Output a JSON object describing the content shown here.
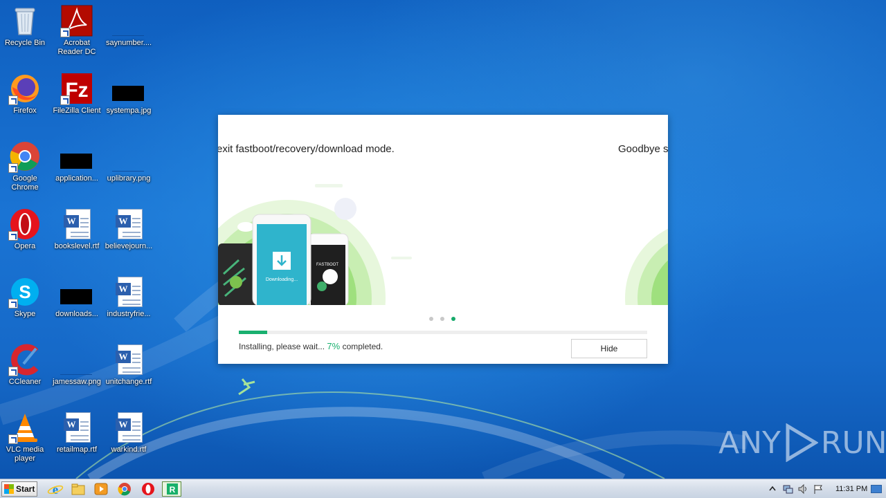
{
  "desktop": {
    "icons": [
      {
        "label": "Recycle Bin"
      },
      {
        "label": "Acrobat Reader DC"
      },
      {
        "label": "saynumber...."
      },
      {
        "label": "Firefox"
      },
      {
        "label": "FileZilla Client"
      },
      {
        "label": "systempa.jpg"
      },
      {
        "label": "Google Chrome"
      },
      {
        "label": "application..."
      },
      {
        "label": "uplibrary.png"
      },
      {
        "label": "Opera"
      },
      {
        "label": "bookslevel.rtf"
      },
      {
        "label": "believejourn..."
      },
      {
        "label": "Skype"
      },
      {
        "label": "downloads..."
      },
      {
        "label": "industryfrie..."
      },
      {
        "label": "CCleaner"
      },
      {
        "label": "jamessaw.png"
      },
      {
        "label": "unitchange.rtf"
      },
      {
        "label": "VLC media player"
      },
      {
        "label": "retailmap.rtf"
      },
      {
        "label": "warkind.rtf"
      }
    ]
  },
  "installer": {
    "slide_text_left": "exit fastboot/recovery/download mode.",
    "slide_text_right": "Goodbye s",
    "phone_screen_text": "Downloading...",
    "phone_fastboot_text": "FASTBOOT",
    "carousel_dots": 3,
    "active_dot": 2,
    "progress_percent": 7,
    "status_prefix": "Installing, please wait...",
    "status_percent": "7%",
    "status_suffix": "completed.",
    "hide_label": "Hide"
  },
  "watermark": {
    "left": "ANY",
    "right": "RUN"
  },
  "taskbar": {
    "start_label": "Start",
    "pinned": [
      "internet-explorer-icon",
      "file-explorer-icon",
      "media-player-icon",
      "chrome-icon",
      "opera-icon",
      "installer-app-icon"
    ],
    "clock": "11:31 PM"
  },
  "colors": {
    "accent_green": "#19b06f",
    "desktop_blue": "#1565c8"
  }
}
